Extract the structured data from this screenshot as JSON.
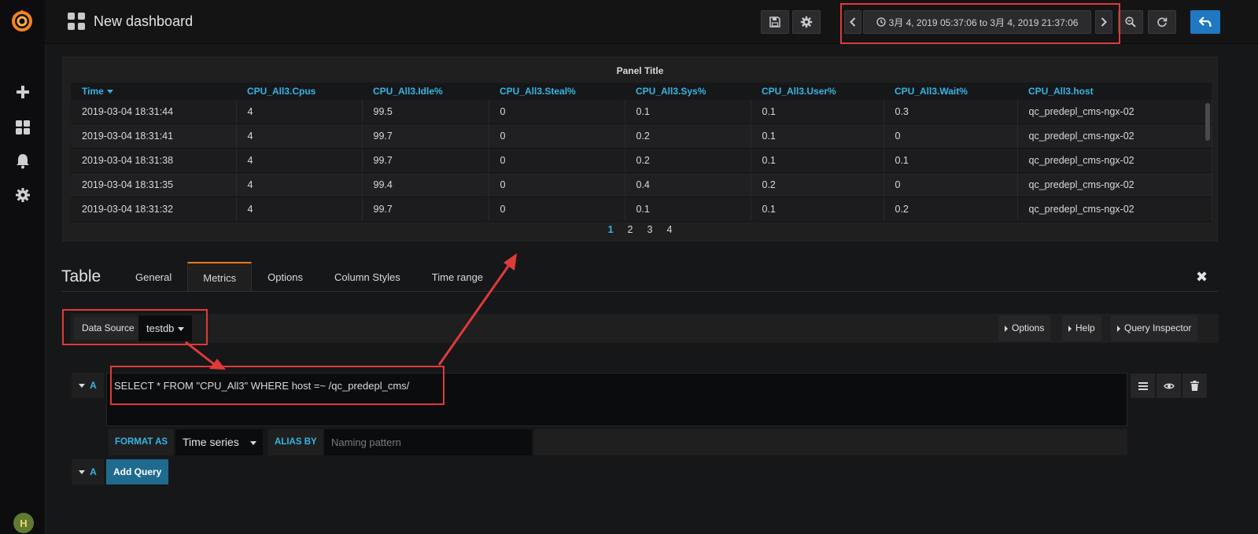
{
  "topnav": {
    "dashboard_title": "New dashboard",
    "time_range": "3月 4, 2019 05:37:06 to 3月 4, 2019 21:37:06",
    "icons": [
      "dashboard-grid-icon",
      "save-icon",
      "gear-icon",
      "chevron-left-icon",
      "clock-icon",
      "chevron-right-icon",
      "zoom-out-icon",
      "refresh-icon",
      "back-arrow-icon"
    ]
  },
  "sidebar": {
    "icons": [
      "grafana-logo-icon",
      "plus-icon",
      "dashboards-icon",
      "bell-icon",
      "gear-icon"
    ],
    "avatar_initial": "H"
  },
  "panel": {
    "title": "Panel Title",
    "columns": [
      "Time",
      "CPU_All3.Cpus",
      "CPU_All3.Idle%",
      "CPU_All3.Steal%",
      "CPU_All3.Sys%",
      "CPU_All3.User%",
      "CPU_All3.Wait%",
      "CPU_All3.host"
    ],
    "rows": [
      [
        "2019-03-04 18:31:44",
        "4",
        "99.5",
        "0",
        "0.1",
        "0.1",
        "0.3",
        "qc_predepl_cms-ngx-02"
      ],
      [
        "2019-03-04 18:31:41",
        "4",
        "99.7",
        "0",
        "0.2",
        "0.1",
        "0",
        "qc_predepl_cms-ngx-02"
      ],
      [
        "2019-03-04 18:31:38",
        "4",
        "99.7",
        "0",
        "0.2",
        "0.1",
        "0.1",
        "qc_predepl_cms-ngx-02"
      ],
      [
        "2019-03-04 18:31:35",
        "4",
        "99.4",
        "0",
        "0.4",
        "0.2",
        "0",
        "qc_predepl_cms-ngx-02"
      ],
      [
        "2019-03-04 18:31:32",
        "4",
        "99.7",
        "0",
        "0.1",
        "0.1",
        "0.2",
        "qc_predepl_cms-ngx-02"
      ]
    ],
    "pages": [
      "1",
      "2",
      "3",
      "4"
    ],
    "active_page": "1"
  },
  "editor": {
    "title": "Table",
    "tabs": [
      "General",
      "Metrics",
      "Options",
      "Column Styles",
      "Time range"
    ],
    "active_tab": "Metrics",
    "close_glyph": "✖"
  },
  "query": {
    "data_source_label": "Data Source",
    "data_source_value": "testdb",
    "options_label": "Options",
    "help_label": "Help",
    "inspector_label": "Query Inspector",
    "ref_id": "A",
    "text": "SELECT * FROM \"CPU_All3\" WHERE host =~ /qc_predepl_cms/",
    "format_as_label": "FORMAT AS",
    "format_as_value": "Time series",
    "alias_by_label": "ALIAS BY",
    "alias_placeholder": "Naming pattern",
    "add_query_label": "Add Query"
  },
  "colors": {
    "accent": "#33b5e5",
    "annotation_red": "#e03a3a",
    "tab_active_border": "#eb7b18",
    "primary_button": "#1f78c1"
  }
}
